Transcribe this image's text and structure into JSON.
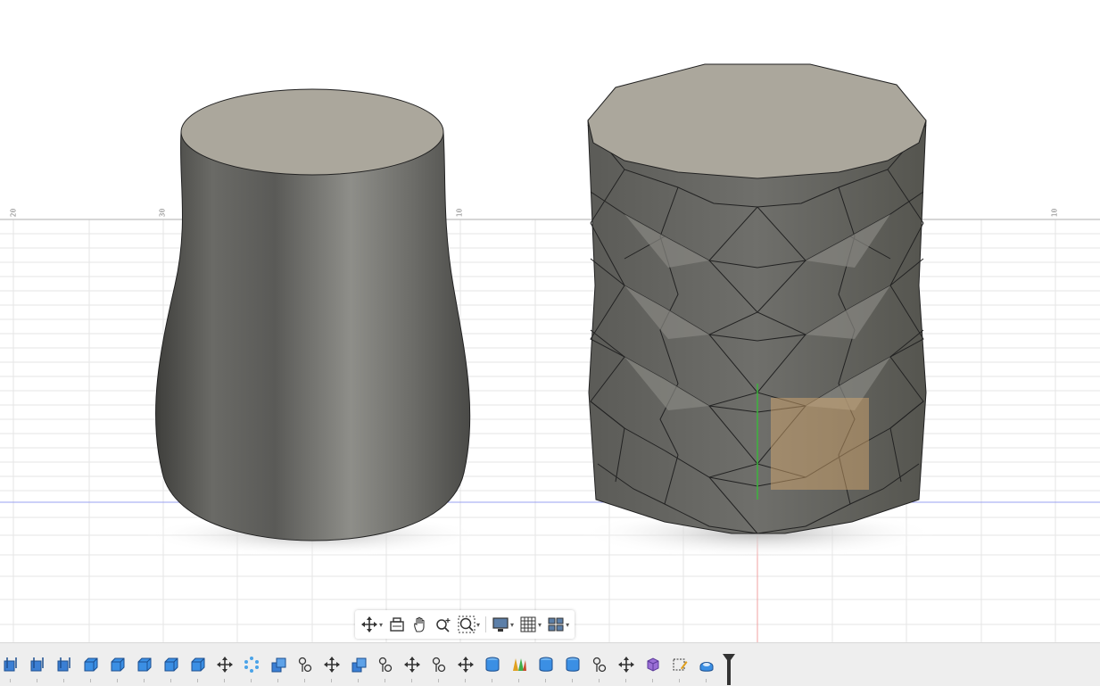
{
  "viewport": {
    "ruler_labels": [
      "20",
      "30",
      "10",
      "10"
    ],
    "colors": {
      "grid": "#dcdcdc",
      "axis_x": "#9aa0f0",
      "axis_y": "#f2a0a0",
      "axis_z": "#3db33d",
      "body": "#6e6e6a",
      "top_face": "#aba79c",
      "highlight": "#e0b070"
    }
  },
  "nav_toolbar": {
    "items": [
      {
        "name": "orbit-icon",
        "has_menu": true
      },
      {
        "name": "look-at-icon",
        "has_menu": false
      },
      {
        "name": "pan-icon",
        "has_menu": false
      },
      {
        "name": "zoom-icon",
        "has_menu": false
      },
      {
        "name": "fit-icon",
        "has_menu": true
      },
      {
        "name": "display-settings-icon",
        "has_menu": true
      },
      {
        "name": "grid-snap-icon",
        "has_menu": true
      },
      {
        "name": "viewports-icon",
        "has_menu": true
      }
    ]
  },
  "timeline": {
    "items": [
      "sketch",
      "sketch",
      "sketch",
      "extrude",
      "extrude",
      "extrude",
      "extrude",
      "extrude",
      "move",
      "pattern",
      "combine",
      "joint",
      "move",
      "combine",
      "joint",
      "move",
      "joint",
      "move",
      "cylinder",
      "form",
      "cylinder",
      "cylinder",
      "joint",
      "move",
      "form-body",
      "sketch-edit",
      "revolve"
    ]
  }
}
